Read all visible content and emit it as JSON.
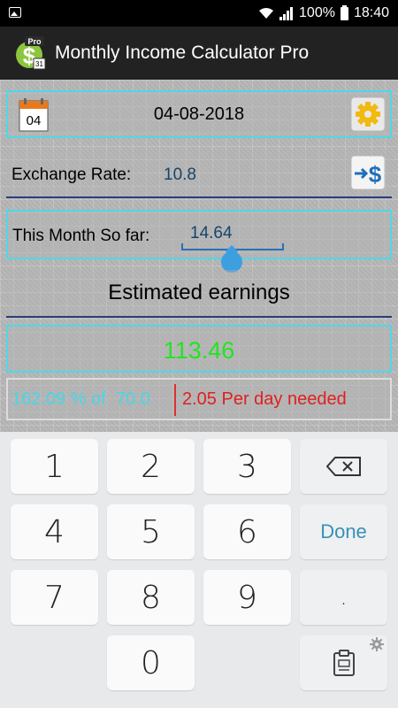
{
  "status_bar": {
    "battery": "100%",
    "time": "18:40"
  },
  "app": {
    "title": "Monthly Income Calculator Pro",
    "icon_text": "Pro",
    "icon_day": "31"
  },
  "date_panel": {
    "calendar_day": "04",
    "date": "04-08-2018"
  },
  "exchange": {
    "label": "Exchange Rate:",
    "value": "10.8"
  },
  "month": {
    "label": "This Month So far:",
    "value": "14.64"
  },
  "estimated": {
    "label": "Estimated earnings",
    "value": "113.46"
  },
  "stats": {
    "percent_text": "162.09 % of  70.0",
    "per_day_text": "2.05 Per day needed"
  },
  "keyboard": {
    "keys": [
      "1",
      "2",
      "3",
      "4",
      "5",
      "6",
      "7",
      "8",
      "9",
      "0"
    ],
    "done_label": "Done",
    "dot_label": "."
  },
  "colors": {
    "accent_cyan": "#4fd8e8",
    "result_green": "#1fe61f",
    "warning_red": "#e02020",
    "value_blue": "#16456b"
  }
}
